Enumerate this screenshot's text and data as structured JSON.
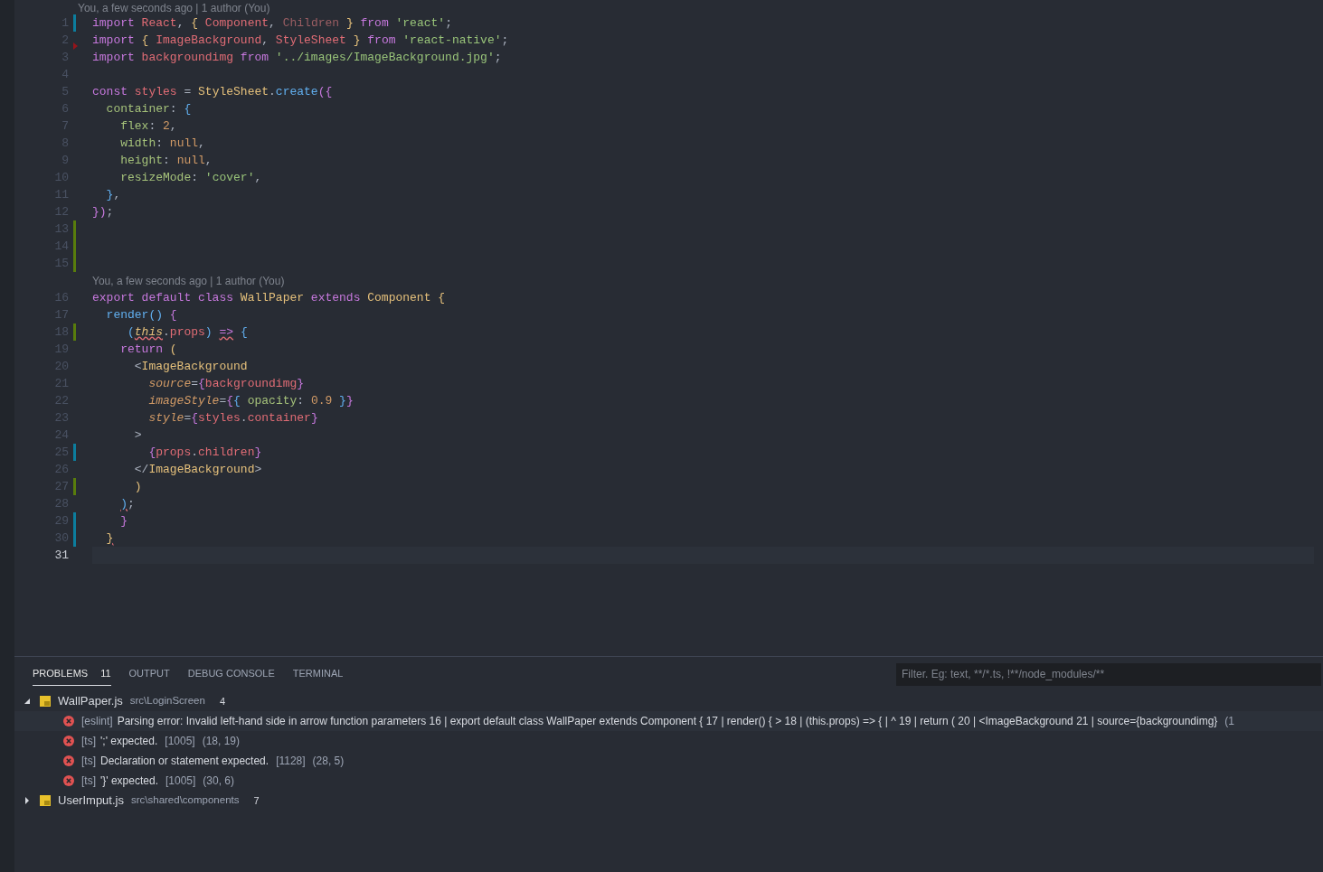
{
  "editor": {
    "blame_top": "You, a few seconds ago | 1 author (You)",
    "lines": [
      {
        "number": "1",
        "gutter": {
          "kind": "modified"
        },
        "tokens": [
          {
            "text": "import ",
            "kind": "kw"
          },
          {
            "text": "React",
            "kind": "var"
          },
          {
            "text": ", ",
            "kind": "p"
          },
          {
            "text": "{ ",
            "kind": "br1"
          },
          {
            "text": "Component",
            "kind": "var"
          },
          {
            "text": ", ",
            "kind": "p"
          },
          {
            "text": "Children",
            "kind": "dim"
          },
          {
            "text": " }",
            "kind": "br1"
          },
          {
            "text": " from ",
            "kind": "kw"
          },
          {
            "text": "'react'",
            "kind": "str"
          },
          {
            "text": ";",
            "kind": "p"
          }
        ]
      },
      {
        "number": "2",
        "gutter": {
          "kind": "deleted"
        },
        "tokens": [
          {
            "text": "import ",
            "kind": "kw"
          },
          {
            "text": "{ ",
            "kind": "br1"
          },
          {
            "text": "ImageBackground",
            "kind": "var"
          },
          {
            "text": ", ",
            "kind": "p"
          },
          {
            "text": "StyleSheet",
            "kind": "var"
          },
          {
            "text": " }",
            "kind": "br1"
          },
          {
            "text": " from ",
            "kind": "kw"
          },
          {
            "text": "'react-native'",
            "kind": "str"
          },
          {
            "text": ";",
            "kind": "p"
          }
        ]
      },
      {
        "number": "3",
        "tokens": [
          {
            "text": "import ",
            "kind": "kw"
          },
          {
            "text": "backgroundimg",
            "kind": "var"
          },
          {
            "text": " from ",
            "kind": "kw"
          },
          {
            "text": "'../images/ImageBackground.jpg'",
            "kind": "str"
          },
          {
            "text": ";",
            "kind": "p"
          }
        ]
      },
      {
        "number": "4"
      },
      {
        "number": "5",
        "tokens": [
          {
            "text": "const ",
            "kind": "kw"
          },
          {
            "text": "styles",
            "kind": "var"
          },
          {
            "text": " = ",
            "kind": "p"
          },
          {
            "text": "StyleSheet",
            "kind": "cls"
          },
          {
            "text": ".",
            "kind": "p"
          },
          {
            "text": "create",
            "kind": "fn"
          },
          {
            "text": "({",
            "kind": "br2"
          }
        ]
      },
      {
        "number": "6",
        "tokens": [
          {
            "text": "  container",
            "kind": "prop"
          },
          {
            "text": ": ",
            "kind": "p"
          },
          {
            "text": "{",
            "kind": "br3"
          }
        ]
      },
      {
        "number": "7",
        "tokens": [
          {
            "text": "    flex",
            "kind": "prop"
          },
          {
            "text": ": ",
            "kind": "p"
          },
          {
            "text": "2",
            "kind": "num"
          },
          {
            "text": ",",
            "kind": "p"
          }
        ]
      },
      {
        "number": "8",
        "tokens": [
          {
            "text": "    width",
            "kind": "prop"
          },
          {
            "text": ": ",
            "kind": "p"
          },
          {
            "text": "null",
            "kind": "num"
          },
          {
            "text": ",",
            "kind": "p"
          }
        ]
      },
      {
        "number": "9",
        "tokens": [
          {
            "text": "    height",
            "kind": "prop"
          },
          {
            "text": ": ",
            "kind": "p"
          },
          {
            "text": "null",
            "kind": "num"
          },
          {
            "text": ",",
            "kind": "p"
          }
        ]
      },
      {
        "number": "10",
        "tokens": [
          {
            "text": "    resizeMode",
            "kind": "prop"
          },
          {
            "text": ": ",
            "kind": "p"
          },
          {
            "text": "'cover'",
            "kind": "str"
          },
          {
            "text": ",",
            "kind": "p"
          }
        ]
      },
      {
        "number": "11",
        "tokens": [
          {
            "text": "  }",
            "kind": "br3"
          },
          {
            "text": ",",
            "kind": "p"
          }
        ]
      },
      {
        "number": "12",
        "tokens": [
          {
            "text": "})",
            "kind": "br2"
          },
          {
            "text": ";",
            "kind": "p"
          }
        ]
      },
      {
        "number": "13",
        "gutter": {
          "kind": "added"
        }
      },
      {
        "number": "14",
        "gutter": {
          "kind": "added"
        }
      },
      {
        "number": "15",
        "gutter": {
          "kind": "added"
        }
      },
      {
        "number": "16",
        "blame": "You, a few seconds ago | 1 author (You)",
        "tokens": [
          {
            "text": "export default class ",
            "kind": "kw"
          },
          {
            "text": "WallPaper",
            "kind": "cls"
          },
          {
            "text": " extends ",
            "kind": "kw"
          },
          {
            "text": "Component",
            "kind": "cls"
          },
          {
            "text": " {",
            "kind": "br1"
          }
        ]
      },
      {
        "number": "17",
        "tokens": [
          {
            "text": "  render",
            "kind": "fn"
          },
          {
            "text": "()",
            "kind": "br3"
          },
          {
            "text": " {",
            "kind": "br2"
          }
        ]
      },
      {
        "number": "18",
        "gutter": {
          "kind": "added"
        },
        "tokens": [
          {
            "text": "     (",
            "kind": "br3"
          },
          {
            "text": "this",
            "kind": "this",
            "error": true
          },
          {
            "text": ".",
            "kind": "p"
          },
          {
            "text": "props",
            "kind": "var"
          },
          {
            "text": ") ",
            "kind": "br3"
          },
          {
            "text": "=>",
            "kind": "kw",
            "error": true
          },
          {
            "text": " {",
            "kind": "br3"
          }
        ]
      },
      {
        "number": "19",
        "tokens": [
          {
            "text": "    return ",
            "kind": "kw"
          },
          {
            "text": "(",
            "kind": "br1"
          }
        ]
      },
      {
        "number": "20",
        "tokens": [
          {
            "text": "      <",
            "kind": "p"
          },
          {
            "text": "ImageBackground",
            "kind": "cls"
          }
        ]
      },
      {
        "number": "21",
        "tokens": [
          {
            "text": "        source",
            "kind": "attr"
          },
          {
            "text": "=",
            "kind": "p"
          },
          {
            "text": "{",
            "kind": "br2"
          },
          {
            "text": "backgroundimg",
            "kind": "var"
          },
          {
            "text": "}",
            "kind": "br2"
          }
        ]
      },
      {
        "number": "22",
        "tokens": [
          {
            "text": "        imageStyle",
            "kind": "attr"
          },
          {
            "text": "=",
            "kind": "p"
          },
          {
            "text": "{",
            "kind": "br2"
          },
          {
            "text": "{",
            "kind": "br3"
          },
          {
            "text": " opacity",
            "kind": "prop"
          },
          {
            "text": ": ",
            "kind": "p"
          },
          {
            "text": "0.9",
            "kind": "num"
          },
          {
            "text": " }",
            "kind": "br3"
          },
          {
            "text": "}",
            "kind": "br2"
          }
        ]
      },
      {
        "number": "23",
        "tokens": [
          {
            "text": "        style",
            "kind": "attr"
          },
          {
            "text": "=",
            "kind": "p"
          },
          {
            "text": "{",
            "kind": "br2"
          },
          {
            "text": "styles",
            "kind": "var"
          },
          {
            "text": ".",
            "kind": "p"
          },
          {
            "text": "container",
            "kind": "var"
          },
          {
            "text": "}",
            "kind": "br2"
          }
        ]
      },
      {
        "number": "24",
        "tokens": [
          {
            "text": "      >",
            "kind": "p"
          }
        ]
      },
      {
        "number": "25",
        "gutter": {
          "kind": "modified"
        },
        "tokens": [
          {
            "text": "        {",
            "kind": "br2"
          },
          {
            "text": "props",
            "kind": "var"
          },
          {
            "text": ".",
            "kind": "p"
          },
          {
            "text": "children",
            "kind": "var"
          },
          {
            "text": "}",
            "kind": "br2"
          }
        ]
      },
      {
        "number": "26",
        "tokens": [
          {
            "text": "      </",
            "kind": "p"
          },
          {
            "text": "ImageBackground",
            "kind": "cls"
          },
          {
            "text": ">",
            "kind": "p"
          }
        ]
      },
      {
        "number": "27",
        "gutter": {
          "kind": "added"
        },
        "tokens": [
          {
            "text": "      )",
            "kind": "br1"
          }
        ]
      },
      {
        "number": "28",
        "tokens": [
          {
            "text": "    )",
            "kind": "br3",
            "error": true
          },
          {
            "text": ";",
            "kind": "p"
          }
        ]
      },
      {
        "number": "29",
        "gutter": {
          "kind": "modified"
        },
        "tokens": [
          {
            "text": "    }",
            "kind": "br2"
          }
        ]
      },
      {
        "number": "30",
        "gutter": {
          "kind": "modified"
        },
        "tokens": [
          {
            "text": "  }",
            "kind": "br1",
            "error": true
          }
        ]
      },
      {
        "number": "31",
        "current": true
      }
    ]
  },
  "panel": {
    "tabs": [
      {
        "label": "PROBLEMS",
        "badge": "11",
        "selected": true
      },
      {
        "label": "OUTPUT",
        "selected": false
      },
      {
        "label": "DEBUG CONSOLE",
        "selected": false
      },
      {
        "label": "TERMINAL",
        "selected": false
      }
    ],
    "filter": {
      "placeholder": "Filter. Eg: text, **/*.ts, !**/node_modules/**"
    },
    "files": [
      {
        "name": "WallPaper.js",
        "path": "src\\LoginScreen",
        "count": "4",
        "expanded": true,
        "problems": [
          {
            "source": "[eslint]",
            "message": "Parsing error: Invalid left-hand side in arrow function parameters 16 | export default class WallPaper extends Component { 17 | render() { > 18 | (this.props) => { | ^ 19 | return ( 20 | <ImageBackground 21 | source={backgroundimg}",
            "position": "(1",
            "selected": true
          },
          {
            "source": "[ts]",
            "message": "';' expected.",
            "code": "[1005]",
            "position": "(18, 19)",
            "selected": false
          },
          {
            "source": "[ts]",
            "message": "Declaration or statement expected.",
            "code": "[1128]",
            "position": "(28, 5)",
            "selected": false
          },
          {
            "source": "[ts]",
            "message": "'}' expected.",
            "code": "[1005]",
            "position": "(30, 6)",
            "selected": false
          }
        ]
      },
      {
        "name": "UserImput.js",
        "path": "src\\shared\\components",
        "count": "7",
        "expanded": false
      }
    ]
  }
}
